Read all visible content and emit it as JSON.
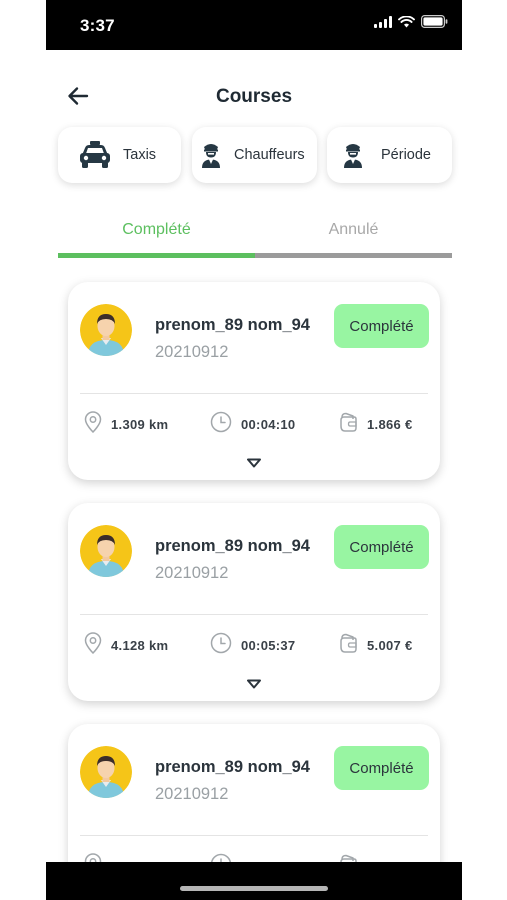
{
  "status_bar": {
    "time": "3:37"
  },
  "header": {
    "title": "Courses",
    "back_icon": "arrow-left-icon"
  },
  "filters": [
    {
      "label": "Taxis",
      "icon": "taxi-icon"
    },
    {
      "label": "Chauffeurs",
      "icon": "driver-icon"
    },
    {
      "label": "Période",
      "icon": "driver-icon"
    }
  ],
  "tabs": {
    "completed_label": "Complété",
    "cancelled_label": "Annulé",
    "active": "completed",
    "active_color": "#5cbf5f",
    "inactive_color": "#9b9b9b"
  },
  "rides": [
    {
      "driver": "prenom_89 nom_94",
      "date": "20210912",
      "status": "Complété",
      "distance": "1.309 km",
      "duration": "00:04:10",
      "price": "1.866 €"
    },
    {
      "driver": "prenom_89 nom_94",
      "date": "20210912",
      "status": "Complété",
      "distance": "4.128 km",
      "duration": "00:05:37",
      "price": "5.007 €"
    },
    {
      "driver": "prenom_89 nom_94",
      "date": "20210912",
      "status": "Complété",
      "distance": "",
      "duration": "",
      "price": ""
    }
  ],
  "colors": {
    "badge_bg": "#98f5a2",
    "avatar_bg": "#f5c518",
    "accent_green": "#5cbf5f"
  }
}
